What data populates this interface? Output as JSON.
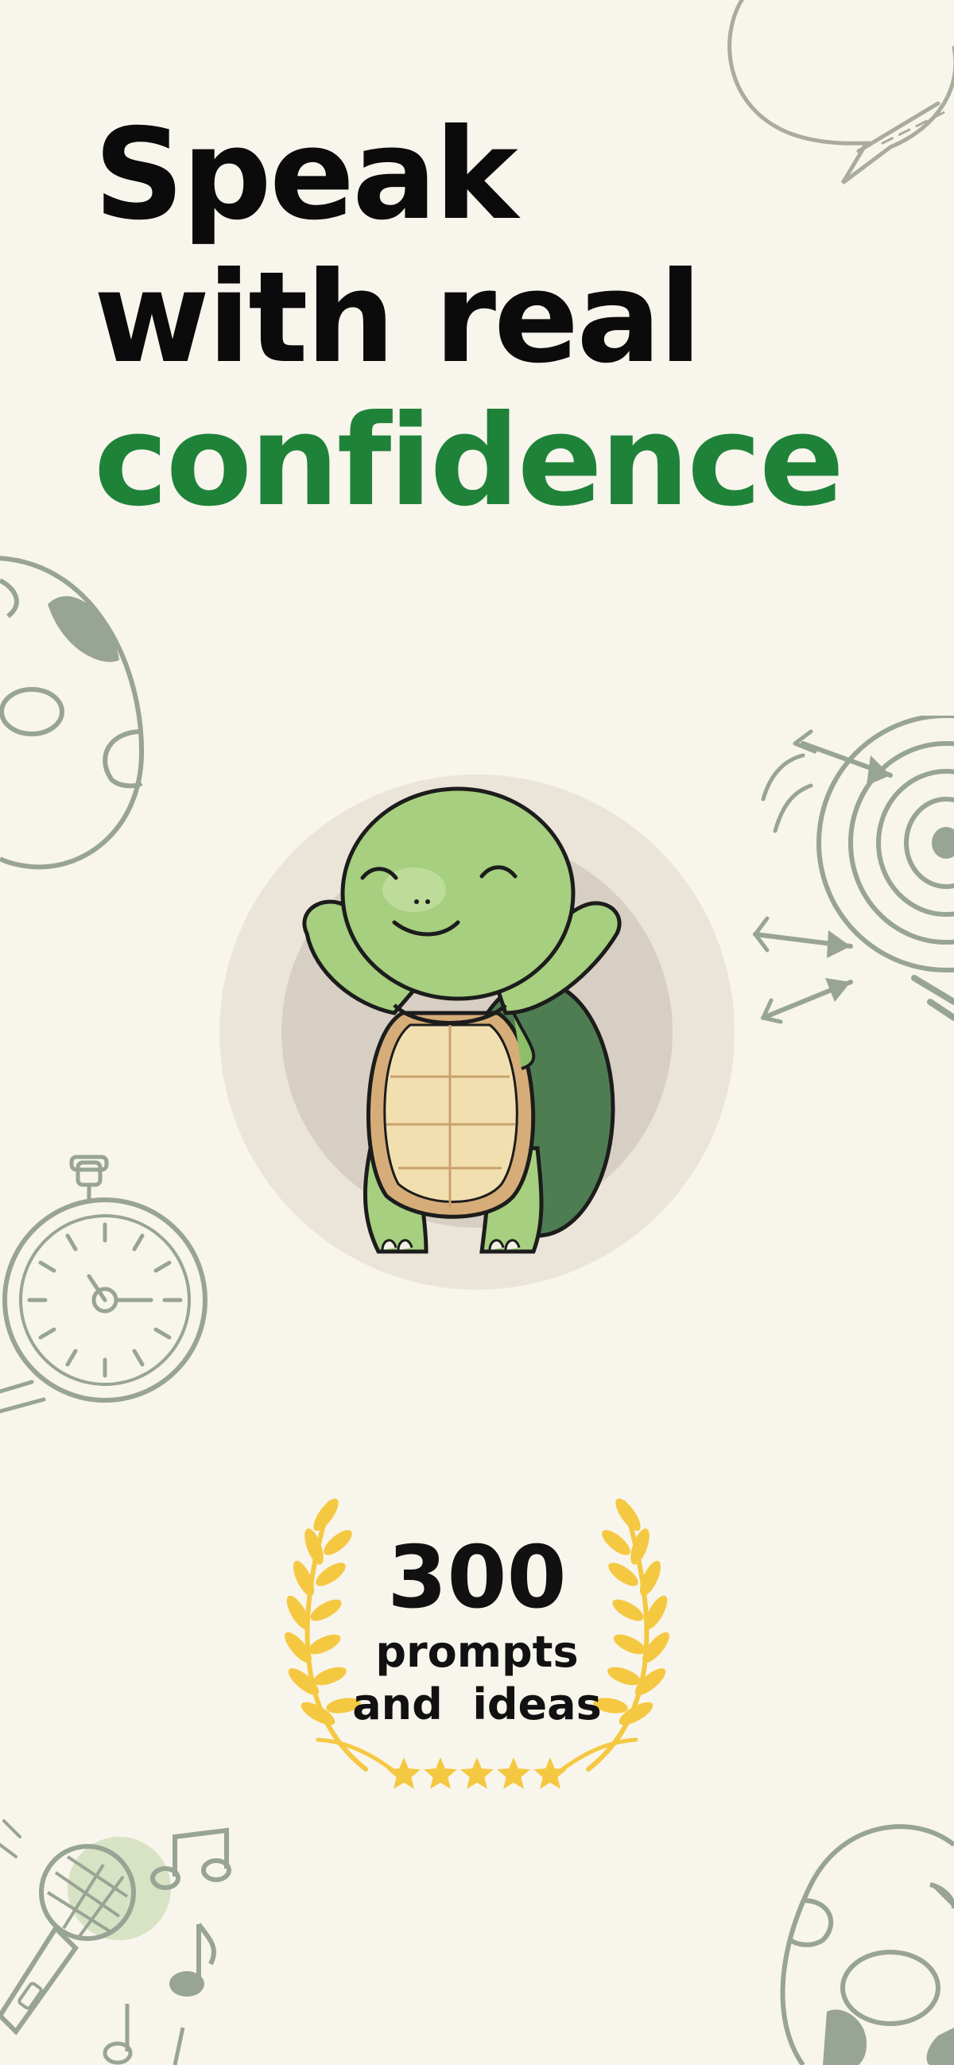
{
  "headline": {
    "line1": "Speak",
    "line2": "with real",
    "line3": "confidence"
  },
  "award": {
    "number": "300",
    "line1": "prompts",
    "line2": "and  ideas",
    "stars": 5
  },
  "colors": {
    "background": "#f8f5ec",
    "accent": "#1f8239",
    "laurel": "#f5c842",
    "doodle": "#9aa597"
  },
  "icons": [
    "speech-bubble-icon",
    "egg-icon",
    "target-arrows-icon",
    "stopwatch-icon",
    "microphone-icon",
    "music-notes-icon",
    "turtle-mascot"
  ]
}
